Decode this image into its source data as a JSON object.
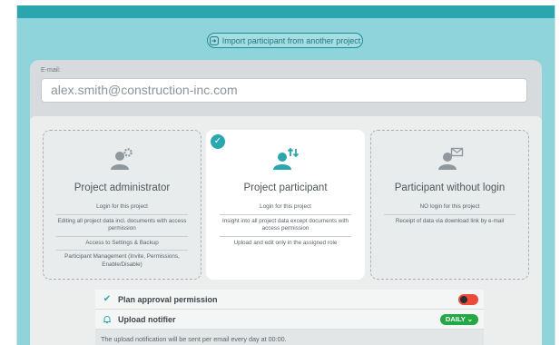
{
  "import_button": {
    "label": "Import participant from another project",
    "icon": "import-icon"
  },
  "email": {
    "label": "E-mail:",
    "value": "alex.smith@construction-inc.com"
  },
  "roles": [
    {
      "title": "Project administrator",
      "icon": "user-gear-icon",
      "selected": false,
      "lines": [
        "Login for this project",
        "Editing all project data incl. documents with access permission",
        "Access to Settings & Backup",
        "Participant Management (Invite, Permissions, Enable/Disable)"
      ]
    },
    {
      "title": "Project participant",
      "icon": "user-transfer-icon",
      "selected": true,
      "lines": [
        "Login for this project",
        "Insight into all project data except documents with access permission",
        "Upload and edit only in the assigned role"
      ]
    },
    {
      "title": "Participant without login",
      "icon": "user-mail-icon",
      "selected": false,
      "lines": [
        "NO login for this project",
        "Receipt of data via download link by e-mail"
      ]
    }
  ],
  "options": {
    "plan_approval": {
      "label": "Plan approval permission",
      "icon": "approval-icon",
      "enabled": true
    },
    "upload_notifier": {
      "label": "Upload notifier",
      "icon": "bell-icon",
      "frequency": "DAILY",
      "note": "The upload notification will be sent per email every day at 00:00."
    }
  },
  "colors": {
    "accent": "#2aa6af",
    "background": "#8fd3db",
    "toggle_on": "#ec4b3c",
    "daily_badge": "#24a845"
  }
}
